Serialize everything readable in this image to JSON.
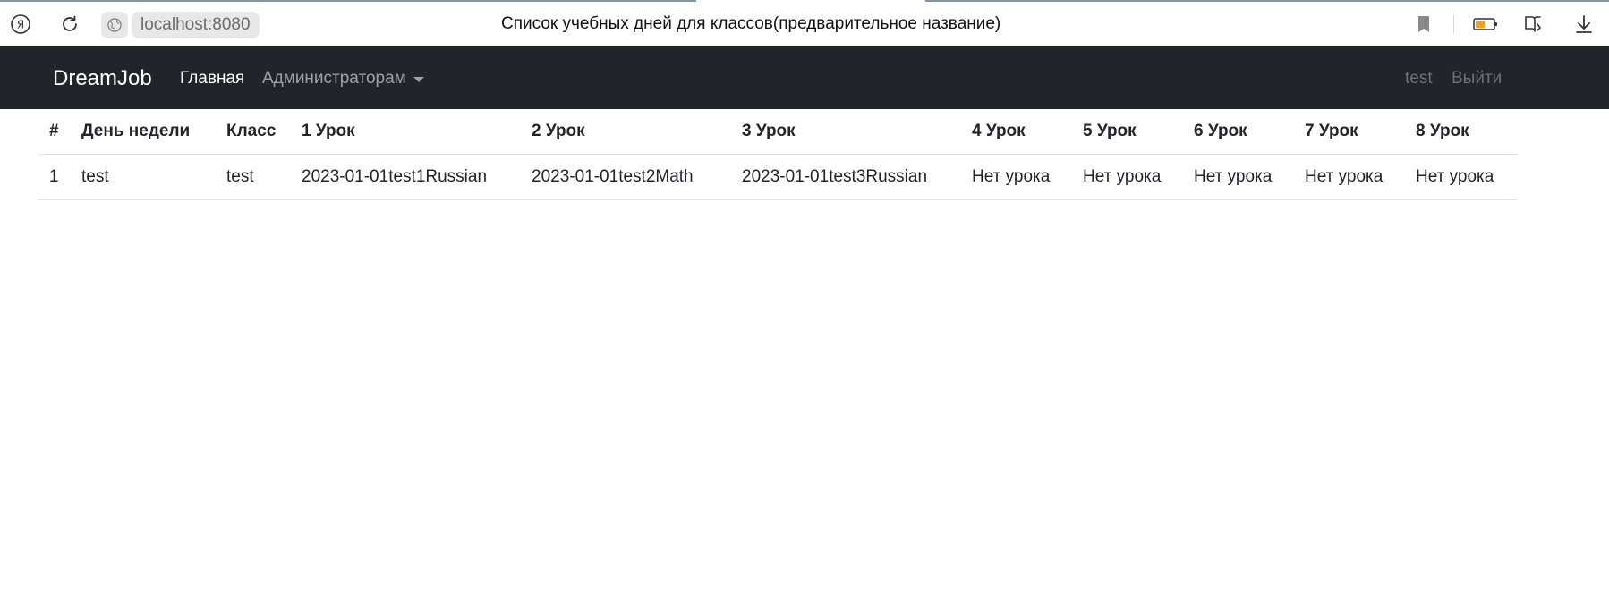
{
  "browser": {
    "url": "localhost:8080",
    "window_title": "Список учебных дней для классов(предварительное название)"
  },
  "navbar": {
    "brand": "DreamJob",
    "home_label": "Главная",
    "admin_label": "Администраторам",
    "user_label": "test",
    "logout_label": "Выйти"
  },
  "table": {
    "headers": [
      "#",
      "День недели",
      "Класс",
      "1 Урок",
      "2 Урок",
      "3 Урок",
      "4 Урок",
      "5 Урок",
      "6 Урок",
      "7 Урок",
      "8 Урок"
    ],
    "rows": [
      [
        "1",
        "test",
        "test",
        "2023-01-01test1Russian",
        "2023-01-01test2Math",
        "2023-01-01test3Russian",
        "Нет урока",
        "Нет урока",
        "Нет урока",
        "Нет урока",
        "Нет урока"
      ]
    ]
  },
  "colors": {
    "navbar_bg": "#212529",
    "accent": "#f0a020"
  },
  "icons": {
    "yandex": "yandex-icon",
    "reload": "reload-icon",
    "site": "site-globe-icon",
    "bookmark": "bookmark-icon",
    "battery": "battery-icon",
    "reader": "reader-mode-icon",
    "download": "download-icon"
  }
}
